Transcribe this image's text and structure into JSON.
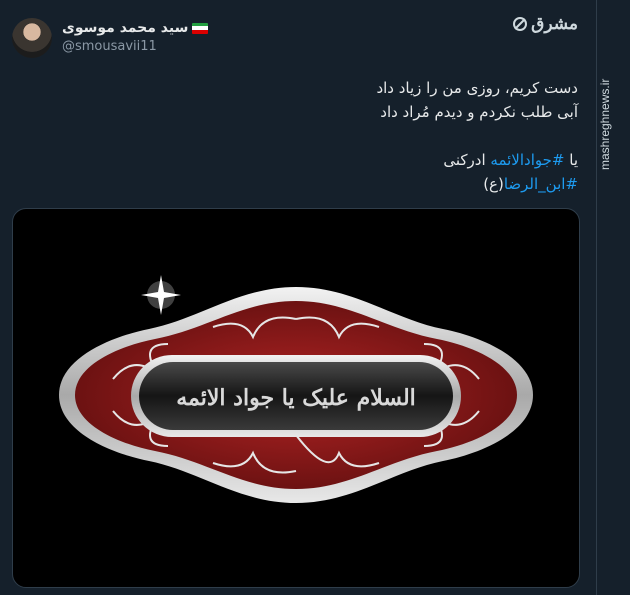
{
  "author": {
    "name": "سید محمد موسوی",
    "handle": "@smousavii11"
  },
  "watermark": {
    "brand": "مشرق",
    "site": "mashreghnews.ir"
  },
  "tweet": {
    "line1": "دست کریم، روزی من را زیاد داد",
    "line2": "آبی طلب نکردم و دیدم مُراد داد",
    "line3_prefix": "یا ",
    "hashtag1": "#جوادالائمه",
    "line3_suffix": " ادرکنی",
    "hashtag2": "#ابن_الرضا",
    "line4_suffix": "(ع)"
  },
  "image": {
    "calligraphy": "السلام علیک یا جواد الائمه"
  },
  "colors": {
    "background": "#15202b",
    "link": "#1d9bf0",
    "frame_red": "#8f1d1d",
    "frame_silver": "#d4d4d4"
  }
}
